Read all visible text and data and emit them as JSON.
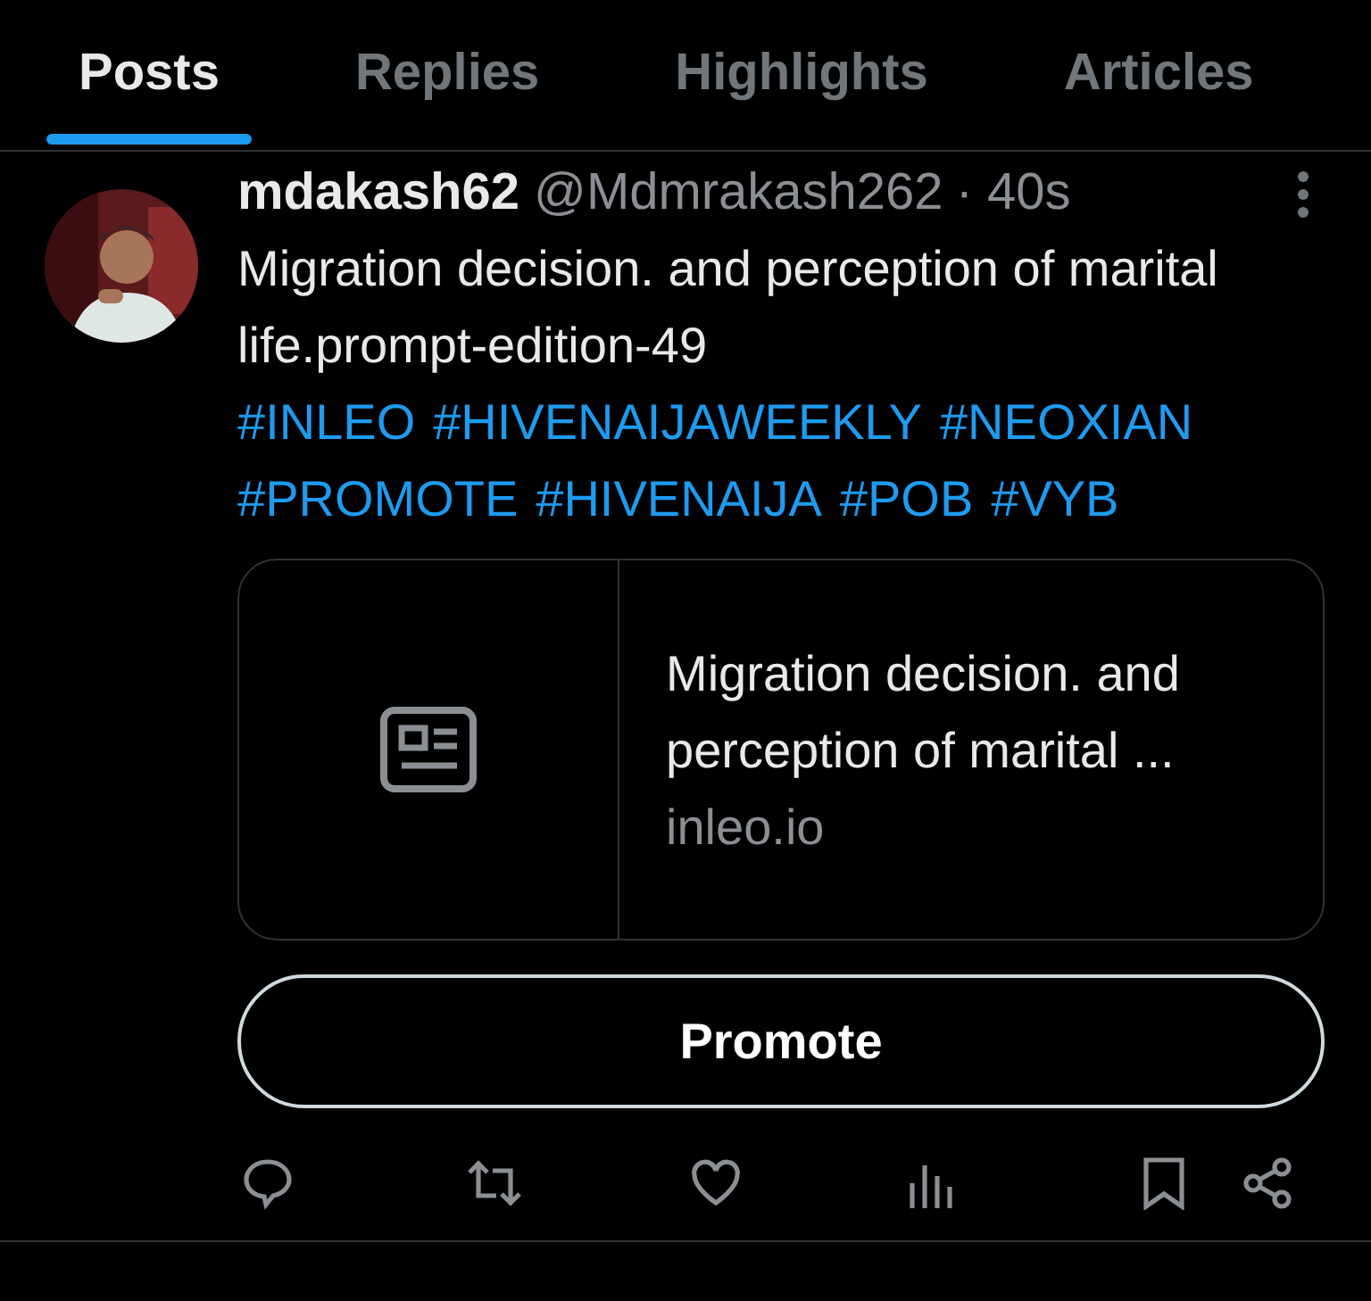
{
  "tabs": [
    {
      "label": "Posts",
      "selected": true
    },
    {
      "label": "Replies",
      "selected": false
    },
    {
      "label": "Highlights",
      "selected": false
    },
    {
      "label": "Articles",
      "selected": false
    }
  ],
  "post": {
    "name": "mdakash62",
    "handle": "@Mdmrakash262",
    "time": "· 40s",
    "text": "Migration decision. and perception of marital life.prompt-edition-49",
    "hashtags": [
      "#INLEO",
      "#HIVENAIJAWEEKLY",
      "#NEOXIAN",
      "#PROMOTE",
      "#HIVENAIJA",
      "#POB",
      "#VYB"
    ],
    "link_card": {
      "title": "Migration decision. and perception of marital ...",
      "domain": "inleo.io"
    },
    "promote_button": "Promote"
  }
}
